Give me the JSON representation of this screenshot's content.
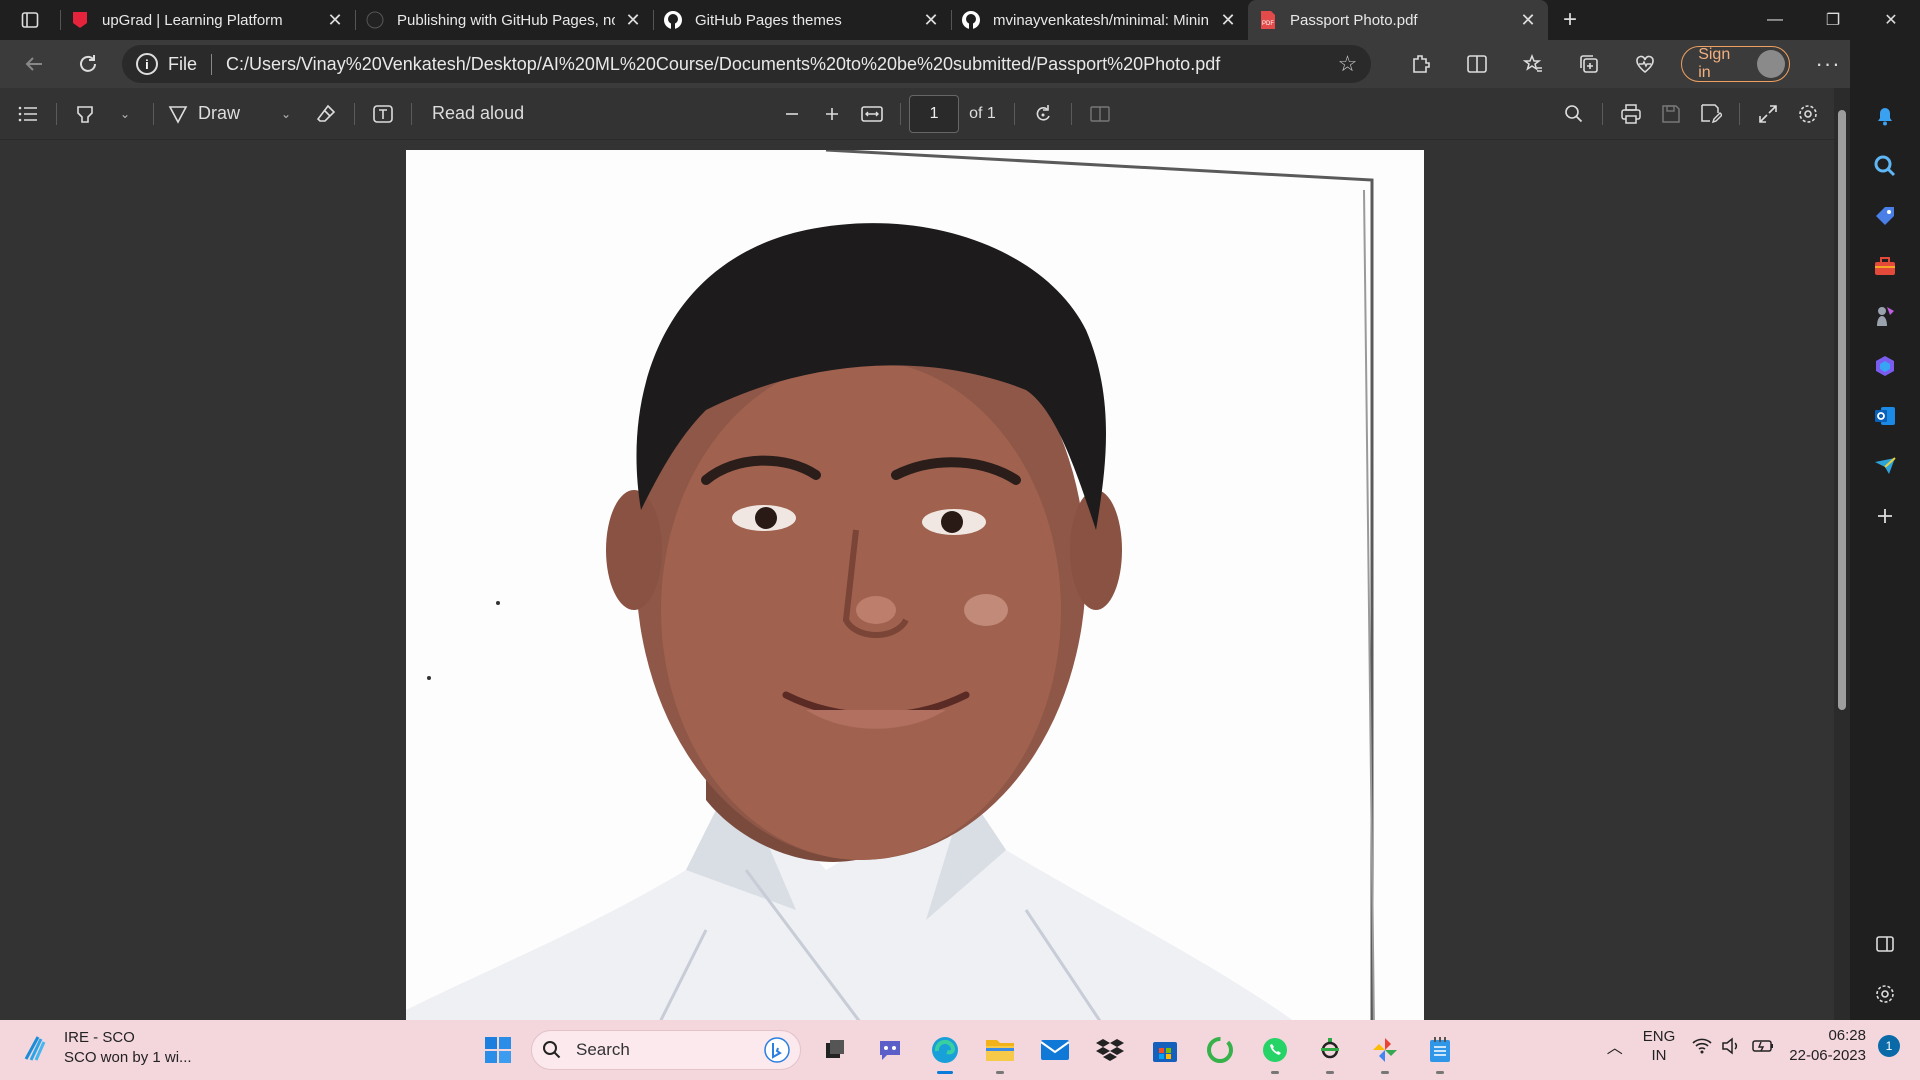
{
  "tabs": [
    {
      "title": "upGrad | Learning Platform",
      "favicon": "upgrad-icon",
      "active": false
    },
    {
      "title": "Publishing with GitHub Pages, no",
      "favicon": "github-icon",
      "active": false
    },
    {
      "title": "GitHub Pages themes",
      "favicon": "github-icon",
      "active": false
    },
    {
      "title": "mvinayvenkatesh/minimal: Minin",
      "favicon": "github-icon",
      "active": false
    },
    {
      "title": "Passport Photo.pdf",
      "favicon": "pdf-icon",
      "active": true
    }
  ],
  "address": {
    "protocol": "File",
    "url": "C:/Users/Vinay%20Venkatesh/Desktop/AI%20ML%20Course/Documents%20to%20be%20submitted/Passport%20Photo.pdf",
    "signin_label": "Sign in"
  },
  "pdf_toolbar": {
    "draw_label": "Draw",
    "read_aloud_label": "Read aloud",
    "page_number": "1",
    "page_total": "of 1"
  },
  "taskbar": {
    "weather_title": "IRE - SCO",
    "weather_sub": "SCO won by 1 wi...",
    "search_placeholder": "Search",
    "lang_top": "ENG",
    "lang_bottom": "IN",
    "time": "06:28",
    "date": "22-06-2023",
    "notification_count": "1"
  },
  "colors": {
    "accent_edge": "#0a84ff",
    "signin_border": "#f0a060",
    "taskbar_bg": "#f4d6dd"
  }
}
